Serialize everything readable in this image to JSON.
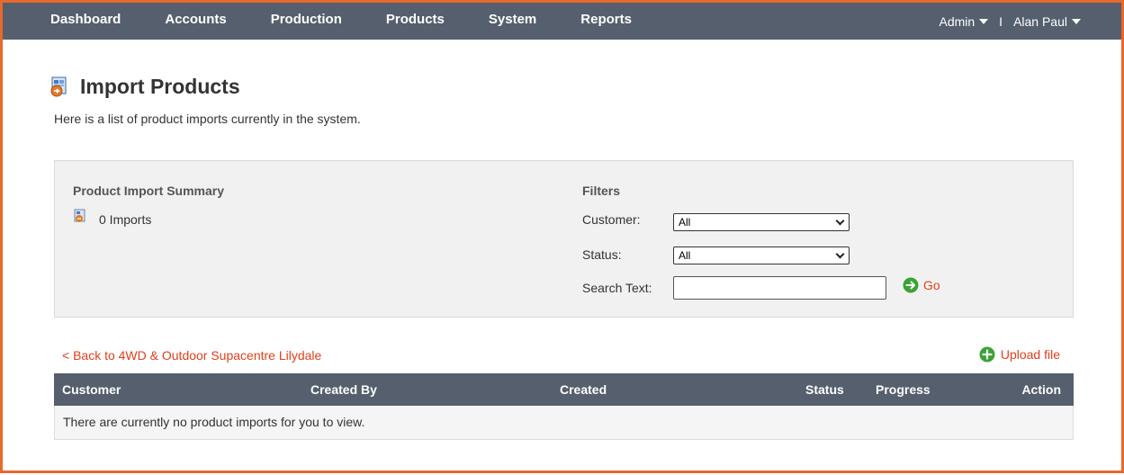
{
  "nav": {
    "items": [
      "Dashboard",
      "Accounts",
      "Production",
      "Products",
      "System",
      "Reports"
    ],
    "admin_label": "Admin",
    "separator": "I",
    "user_label": "Alan Paul"
  },
  "page": {
    "title": "Import Products",
    "subtitle": "Here is a list of product imports currently in the system."
  },
  "summary": {
    "heading": "Product Import Summary",
    "count_text": "0 Imports"
  },
  "filters": {
    "heading": "Filters",
    "customer_label": "Customer:",
    "customer_value": "All",
    "status_label": "Status:",
    "status_value": "All",
    "search_label": "Search Text:",
    "search_value": "",
    "go_label": "Go"
  },
  "links": {
    "back": "< Back to 4WD & Outdoor Supacentre Lilydale",
    "upload": "Upload file"
  },
  "table": {
    "columns": [
      "Customer",
      "Created By",
      "Created",
      "Status",
      "Progress",
      "Action"
    ],
    "empty_message": "There are currently no product imports for you to view."
  },
  "colors": {
    "nav_bg": "#555f6e",
    "accent": "#e0401c",
    "frame_border": "#e8692c",
    "go_green": "#3aa336"
  },
  "icons": {
    "title": "import-products-icon",
    "summary": "import-summary-icon",
    "go": "go-arrow-icon",
    "upload": "add-circle-icon"
  }
}
